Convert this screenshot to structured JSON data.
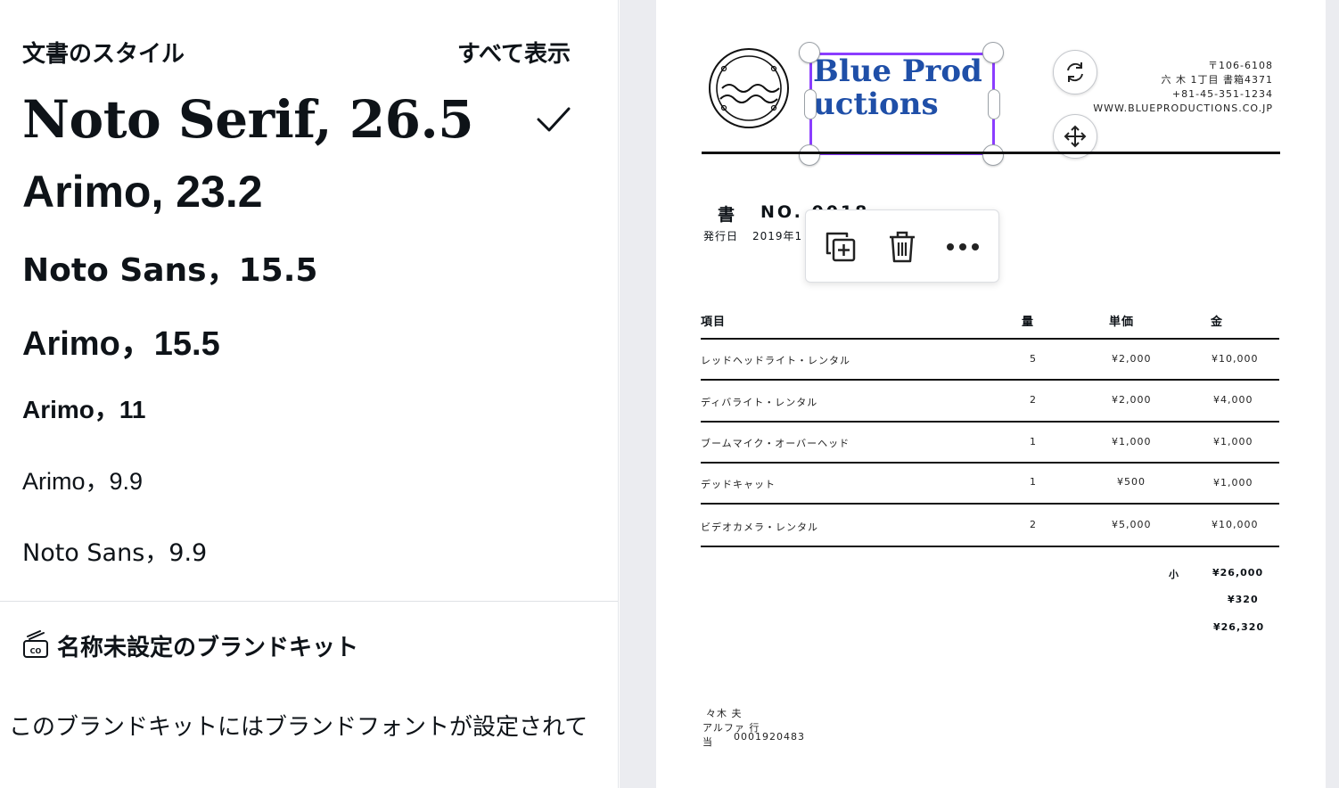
{
  "sidebar": {
    "section_title": "文書のスタイル",
    "see_all": "すべて表示",
    "styles": [
      {
        "label": "Noto Serif, 26.5",
        "selected": true
      },
      {
        "label": "Arimo, 23.2"
      },
      {
        "label": "Noto Sans，15.5"
      },
      {
        "label": "Arimo，15.5"
      },
      {
        "label": "Arimo，11"
      },
      {
        "label": "Arimo，9.9"
      },
      {
        "label": "Noto Sans，9.9"
      }
    ],
    "brand_kit_title": "名称未設定のブランドキット",
    "brand_kit_desc": "このブランドキットにはブランドフォントが設定されていません",
    "brand_kit_icon_text": "CO"
  },
  "invoice": {
    "company_name": "Blue Productions",
    "address_lines": [
      "〒106-6108",
      "六 木 1丁目 書箱4371",
      "+81-45-351-1234",
      "WWW.BLUEPRODUCTIONS.CO.JP"
    ],
    "title": "書",
    "number": "NO. 0018",
    "issue_label": "発行日",
    "issue_date": "2019年1",
    "headers": {
      "item": "項目",
      "qty": "量",
      "unit": "単価",
      "amount": "金"
    },
    "rows": [
      {
        "item": "レッドヘッドライト・レンタル",
        "qty": "5",
        "unit": "¥2,000",
        "amount": "¥10,000"
      },
      {
        "item": "ディバライト・レンタル",
        "qty": "2",
        "unit": "¥2,000",
        "amount": "¥4,000"
      },
      {
        "item": "ブームマイク・オーバーヘッド",
        "qty": "1",
        "unit": "¥1,000",
        "amount": "¥1,000"
      },
      {
        "item": "デッドキャット",
        "qty": "1",
        "unit": "¥500",
        "amount": "¥1,000"
      },
      {
        "item": "ビデオカメラ・レンタル",
        "qty": "2",
        "unit": "¥5,000",
        "amount": "¥10,000"
      }
    ],
    "subtotal_label": "小",
    "subtotal": "¥26,000",
    "tax": "¥320",
    "total": "¥26,320",
    "payment_lines": [
      "々木 夫",
      "アルファ 行",
      "当",
      "0001920483"
    ]
  },
  "colors": {
    "selection": "#8b3dff",
    "company_text": "#1f4fa8"
  }
}
